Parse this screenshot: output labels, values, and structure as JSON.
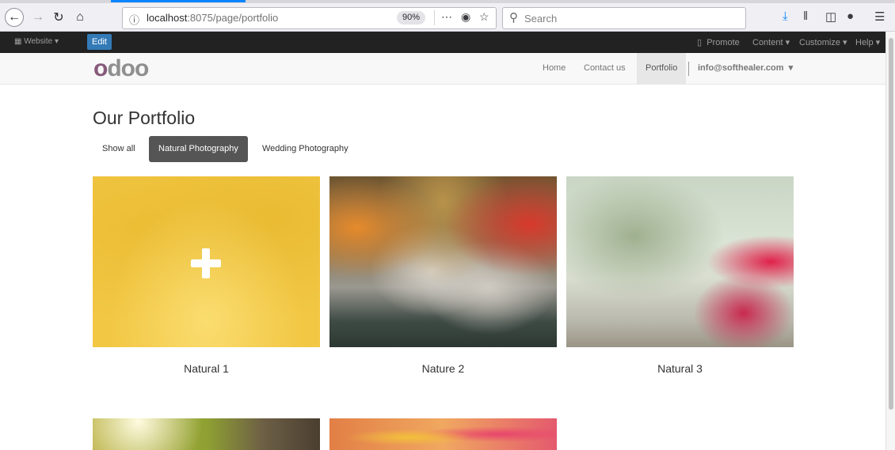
{
  "browser": {
    "url_host": "localhost",
    "url_rest": ":8075/page/portfolio",
    "zoom": "90%",
    "search_placeholder": "Search"
  },
  "admin_bar": {
    "website_menu": "Website",
    "edit_label": "Edit",
    "promote": "Promote",
    "content": "Content",
    "customize": "Customize",
    "help": "Help"
  },
  "header": {
    "logo_first": "o",
    "logo_rest": "doo",
    "nav": [
      "Home",
      "Contact us",
      "Portfolio"
    ],
    "user": "info@softhealer.com"
  },
  "page": {
    "title": "Our Portfolio",
    "filters": [
      "Show all",
      "Natural Photography",
      "Wedding Photography"
    ],
    "active_filter": "Natural Photography",
    "items": [
      {
        "caption": "Natural 1"
      },
      {
        "caption": "Nature 2"
      },
      {
        "caption": "Natural 3"
      }
    ]
  },
  "colors": {
    "odoo_purple": "#875a7b",
    "edit_button": "#337ab7",
    "active_filter": "#555555",
    "admin_bar": "#222222"
  }
}
